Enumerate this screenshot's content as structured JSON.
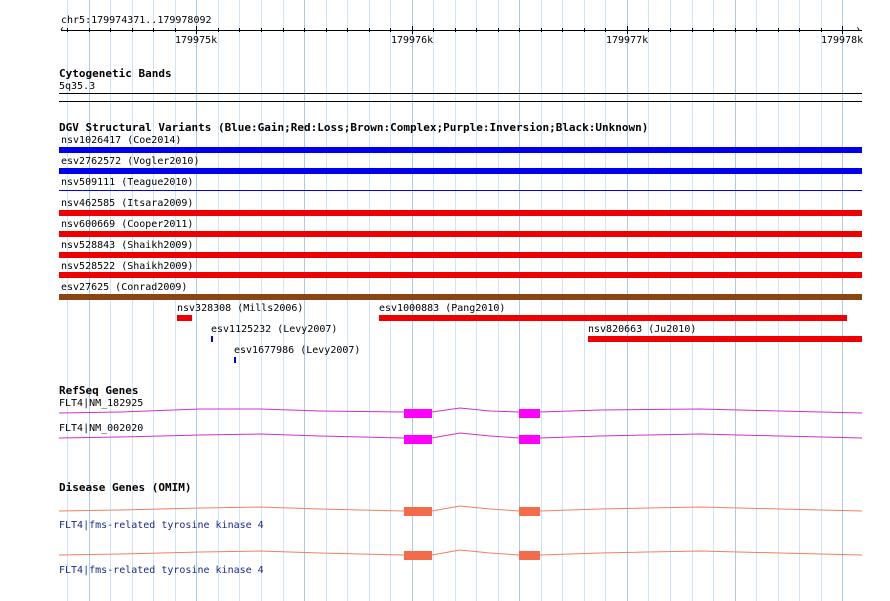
{
  "ruler": {
    "location": "chr5:179974371..179978092",
    "ticks": [
      {
        "label": "179975k",
        "pos": 179975000
      },
      {
        "label": "179976k",
        "pos": 179976000
      },
      {
        "label": "179977k",
        "pos": 179977000
      },
      {
        "label": "179978k",
        "pos": 179978000
      }
    ]
  },
  "cytoband": {
    "title": "Cytogenetic Bands",
    "band": "5q35.3"
  },
  "dgv": {
    "title": "DGV Structural Variants (Blue:Gain;Red:Loss;Brown:Complex;Purple:Inversion;Black:Unknown)",
    "colors": {
      "gain": "#0000ee",
      "loss": "#ee0000",
      "complex": "#8b4513"
    },
    "full_variants": [
      {
        "label": "nsv1026417 (Coe2014)",
        "type": "gain"
      },
      {
        "label": "esv2762572 (Vogler2010)",
        "type": "gain"
      },
      {
        "label": "nsv509111 (Teague2010)",
        "type": "gain-thin"
      },
      {
        "label": "nsv462585 (Itsara2009)",
        "type": "loss"
      },
      {
        "label": "nsv600669 (Cooper2011)",
        "type": "loss"
      },
      {
        "label": "nsv528843 (Shaikh2009)",
        "type": "loss"
      },
      {
        "label": "nsv528522 (Shaikh2009)",
        "type": "loss"
      },
      {
        "label": "esv27625 (Conrad2009)",
        "type": "complex"
      }
    ],
    "partial_variants": [
      {
        "label": "nsv328308 (Mills2006)",
        "type": "loss"
      },
      {
        "label": "esv1000883 (Pang2010)",
        "type": "loss"
      },
      {
        "label": "esv1125232 (Levy2007)",
        "type": "gain"
      },
      {
        "label": "nsv820663 (Ju2010)",
        "type": "loss"
      },
      {
        "label": "esv1677986 (Levy2007)",
        "type": "gain"
      }
    ]
  },
  "refseq": {
    "title": "RefSeq Genes",
    "color": "#ff00ff",
    "line_color": "#cc33cc",
    "genes": [
      {
        "label": "FLT4|NM_182925"
      },
      {
        "label": "FLT4|NM_002020"
      }
    ]
  },
  "omim": {
    "title": "Disease Genes (OMIM)",
    "color": "#f26b4a",
    "line_color": "#f08060",
    "genes": [
      {
        "label": "FLT4|fms-related tyrosine kinase 4"
      },
      {
        "label": "FLT4|fms-related tyrosine kinase 4"
      }
    ]
  }
}
